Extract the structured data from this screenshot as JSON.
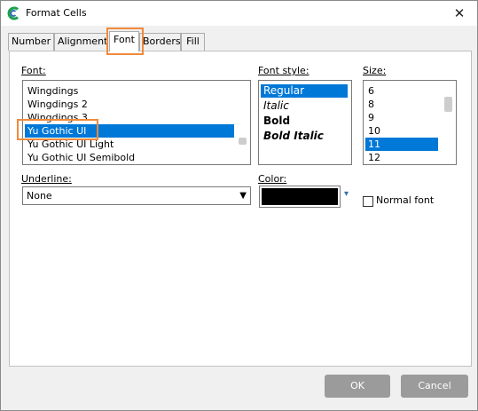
{
  "window": {
    "title": "Format Cells",
    "close_glyph": "✕"
  },
  "tabs": [
    {
      "label": "Number"
    },
    {
      "label": "Alignment"
    },
    {
      "label": "Font"
    },
    {
      "label": "Borders"
    },
    {
      "label": "Fill"
    }
  ],
  "font": {
    "label": "Font:",
    "items": [
      "Wingdings",
      "Wingdings 2",
      "Wingdings 3",
      "Yu Gothic UI",
      "Yu Gothic UI Light",
      "Yu Gothic UI Semibold"
    ],
    "selected": "Yu Gothic UI"
  },
  "font_style": {
    "label": "Font style:",
    "items": [
      "Regular",
      "Italic",
      "Bold",
      "Bold Italic"
    ],
    "selected": "Regular"
  },
  "size": {
    "label": "Size:",
    "items": [
      "6",
      "8",
      "9",
      "10",
      "11",
      "12"
    ],
    "selected": "11"
  },
  "underline": {
    "label": "Underline:",
    "value": "None",
    "arrow": "▼"
  },
  "color": {
    "label": "Color:",
    "value": "#000000",
    "arrow": "▾"
  },
  "normal_font": {
    "label": "Normal font",
    "checked": false
  },
  "buttons": {
    "ok": "OK",
    "cancel": "Cancel"
  },
  "colors": {
    "accent": "#0078d7",
    "highlight": "#f08a3c",
    "button": "#9b9b9b"
  }
}
